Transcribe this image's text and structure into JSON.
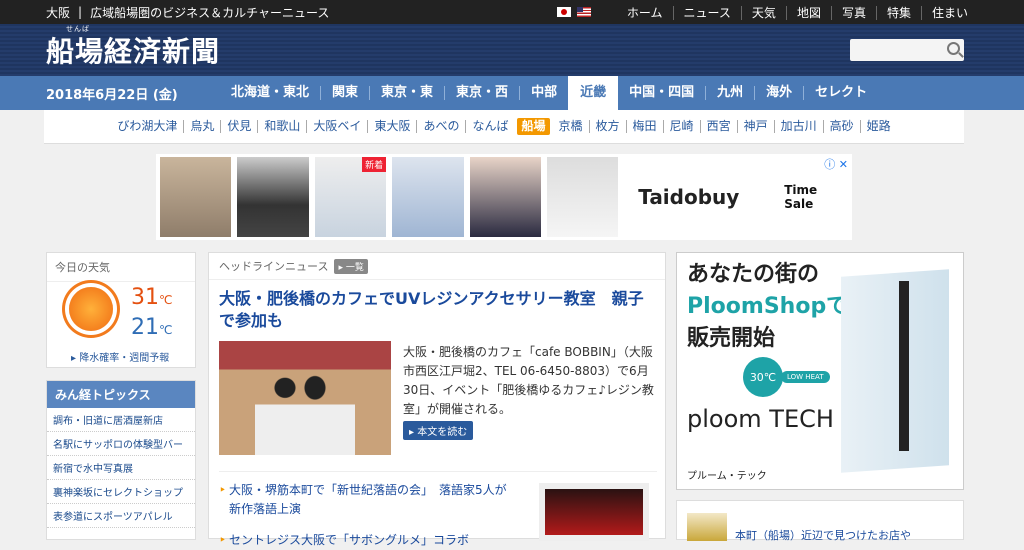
{
  "topbar": {
    "location": "大阪",
    "tagline": "広域船場圏のビジネス＆カルチャーニュース",
    "nav": [
      "ホーム",
      "ニュース",
      "天気",
      "地図",
      "写真",
      "特集",
      "住まい"
    ]
  },
  "header": {
    "logo_ruby": "せんば",
    "logo": "船場経済新聞"
  },
  "regionbar": {
    "date": "2018年6月22日 (金)",
    "regions": [
      "北海道・東北",
      "関東",
      "東京・東",
      "東京・西",
      "中部",
      "近畿",
      "中国・四国",
      "九州",
      "海外",
      "セレクト"
    ],
    "active_region": "近畿"
  },
  "cities": {
    "list": [
      "びわ湖大津",
      "烏丸",
      "伏見",
      "和歌山",
      "大阪ベイ",
      "東大阪",
      "あべの",
      "なんば",
      "船場",
      "京橋",
      "枚方",
      "梅田",
      "尼崎",
      "西宮",
      "神戸",
      "加古川",
      "高砂",
      "姫路"
    ],
    "active": "船場"
  },
  "ad": {
    "new_tag": "新着",
    "brand": "Taidobuy",
    "sale": "Time Sale",
    "close": "ⓘ ✕"
  },
  "weather": {
    "title": "今日の天気",
    "high": "31",
    "low": "21",
    "unit": "℃",
    "link": "降水確率・週間予報"
  },
  "topics": {
    "title": "みん経トピックス",
    "items": [
      "調布・旧道に居酒屋新店",
      "名駅にサッポロの体験型バー",
      "新宿で水中写真展",
      "裏神楽坂にセレクトショップ",
      "表参道にスポーツアパレル"
    ]
  },
  "news": {
    "section": "ヘッドラインニュース",
    "more": "一覧",
    "headline": "大阪・肥後橋のカフェでUVレジンアクセサリー教室　親子で参加も",
    "body": "大阪・肥後橋のカフェ「cafe BOBBIN」（大阪市西区江戸堀2、TEL 06-6450-8803）で6月30日、イベント「肥後橋ゆるカフェ♪レジン教室」が開催される。",
    "read": "本文を読む",
    "sub1": "大阪・堺筋本町で「新世紀落語の会」　落語家5人が新作落語上演",
    "sub2": "セントレジス大阪で「サボングルメ」コラボ"
  },
  "rightad": {
    "line1": "あなたの街の",
    "line2": "PloomShopで",
    "line3": "販売開始",
    "temp": "30℃",
    "lowheat": "LOW HEAT",
    "brand": "ploom TECH",
    "sub": "プルーム・テック"
  },
  "rightbottom": {
    "text": "本町（船場）近辺で見つけたお店や"
  }
}
